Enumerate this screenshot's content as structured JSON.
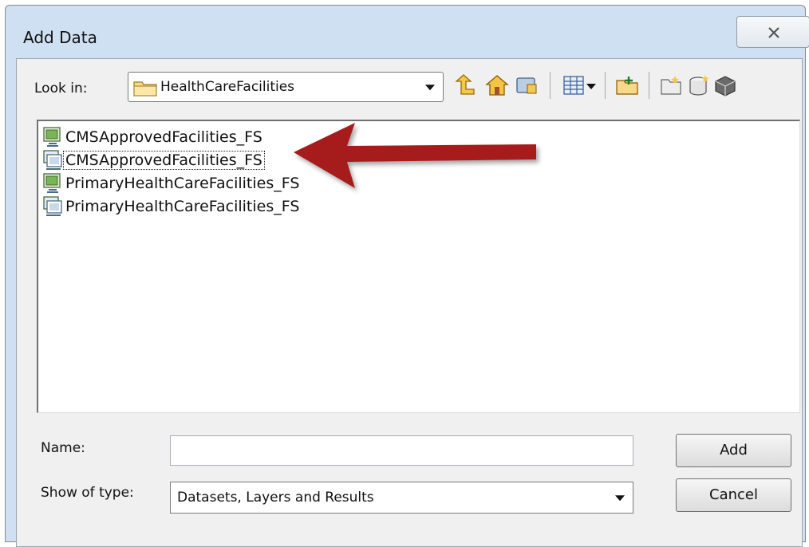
{
  "window": {
    "title": "Add Data"
  },
  "look_in": {
    "label": "Look in:",
    "value": "HealthCareFacilities"
  },
  "toolbar": {
    "icons": [
      "up-one-level-icon",
      "home-icon",
      "connect-to-folder-icon",
      "view-list-icon",
      "view-dropdown-icon",
      "new-folder-icon",
      "new-file-icon",
      "new-database-icon",
      "new-toolbox-icon"
    ]
  },
  "list": {
    "items": [
      {
        "label": "CMSApprovedFacilities_FS",
        "icon": "layer-icon",
        "selected": false
      },
      {
        "label": "CMSApprovedFacilities_FS",
        "icon": "map-service-icon",
        "selected": true
      },
      {
        "label": "PrimaryHealthCareFacilities_FS",
        "icon": "layer-icon",
        "selected": false
      },
      {
        "label": "PrimaryHealthCareFacilities_FS",
        "icon": "map-service-icon",
        "selected": false
      }
    ]
  },
  "name": {
    "label": "Name:",
    "value": ""
  },
  "type": {
    "label": "Show of type:",
    "value": "Datasets, Layers and Results"
  },
  "buttons": {
    "add": "Add",
    "cancel": "Cancel"
  },
  "colors": {
    "annotation_arrow": "#a61b1b",
    "window_frame": "#cfe0f2"
  }
}
